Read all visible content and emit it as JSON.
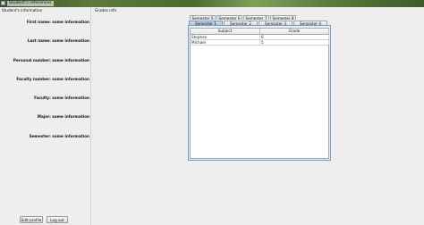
{
  "window": {
    "title": "Student's references"
  },
  "left": {
    "header": "Student's information",
    "fields": [
      {
        "label": "First name:",
        "value": "some information"
      },
      {
        "label": "Last name:",
        "value": "some information"
      },
      {
        "label": "Personal number:",
        "value": "some information"
      },
      {
        "label": "Faculty number:",
        "value": "some information"
      },
      {
        "label": "Faculty:",
        "value": "some information"
      },
      {
        "label": "Major:",
        "value": "some information"
      },
      {
        "label": "Semester:",
        "value": "some information"
      }
    ],
    "buttons": {
      "edit": "Edit profile",
      "logout": "Log out"
    }
  },
  "right": {
    "header": "Grades info",
    "tabs_top": [
      "Semester 5",
      "Semester 6",
      "Semester 7",
      "Semester 8"
    ],
    "tabs_bottom": [
      "Semester 1",
      "Semester 2",
      "Semester 3",
      "Semester 4"
    ],
    "active_tab": "Semester 1",
    "table": {
      "columns": [
        "Subject",
        "Grade"
      ],
      "rows": [
        [
          "Stephen",
          "6"
        ],
        [
          "Michael",
          "5"
        ]
      ]
    }
  },
  "colors": {
    "active_tab": "#b8d2ec",
    "panel_border": "#7e9bbd"
  }
}
